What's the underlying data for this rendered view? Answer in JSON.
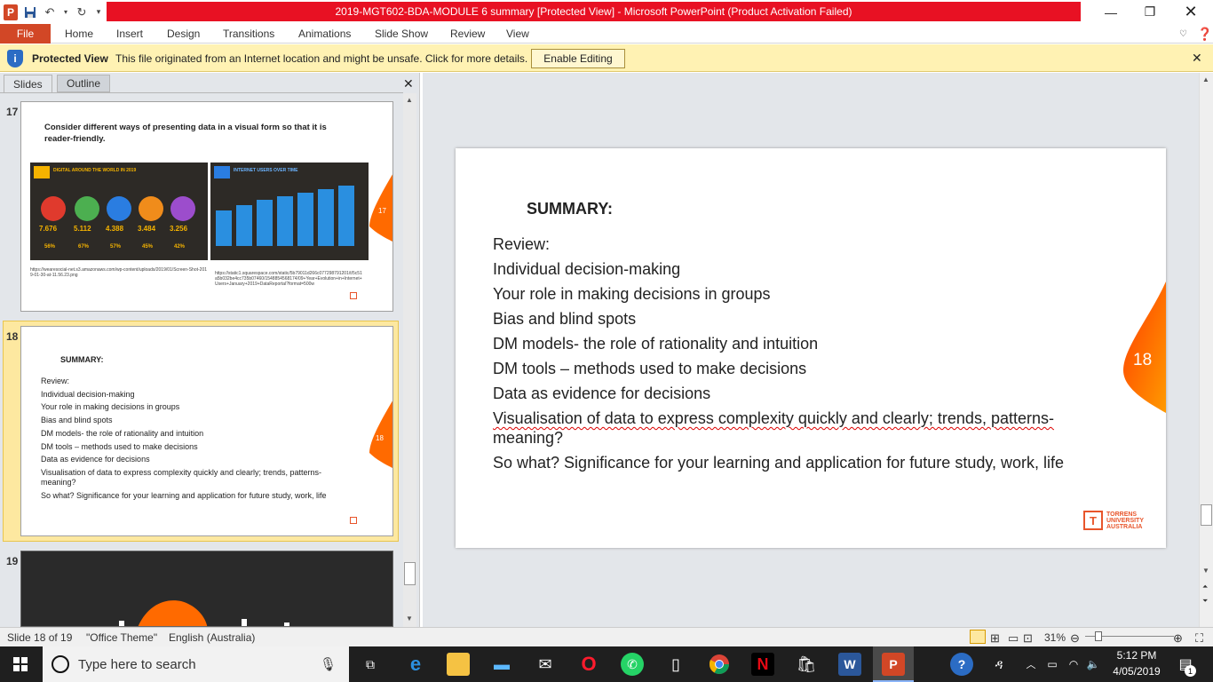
{
  "window": {
    "title": "2019-MGT602-BDA-MODULE 6 summary [Protected View]  -  Microsoft PowerPoint (Product Activation Failed)",
    "app_icon": "P"
  },
  "ribbon": {
    "file": "File",
    "tabs": [
      "Home",
      "Insert",
      "Design",
      "Transitions",
      "Animations",
      "Slide Show",
      "Review",
      "View"
    ]
  },
  "protected": {
    "title": "Protected View",
    "message": "This file originated from an Internet location and might be unsafe. Click for more details.",
    "button": "Enable Editing"
  },
  "panel": {
    "tabs": [
      "Slides",
      "Outline"
    ],
    "slide17": {
      "number": "17",
      "heading": "Consider different ways of presenting data in a visual form so that it is reader-friendly.",
      "img1_title": "DIGITAL AROUND THE WORLD IN 2019",
      "img1_stats": [
        "7.676",
        "5.112",
        "4.388",
        "3.484",
        "3.256"
      ],
      "img1_pcts": [
        "56%",
        "67%",
        "57%",
        "45%",
        "42%"
      ],
      "img2_title": "INTERNET USERS OVER TIME",
      "caption1": "https://wearesocial-net.s3.amazonaws.com/wp-content/uploads/2019/01/Screen-Shot-2019-01-30-at-11.56.23.png",
      "caption2": "https://static1.squarespace.com/static/5b79011d266c077298791201/t/5c51a5b032be4cc735b07460/1548854568174/09+Year+Evolution+in+Internet+Users+January+2019+DataReportal?format=500w",
      "page_badge": "17"
    },
    "slide18": {
      "number": "18",
      "heading": "SUMMARY:",
      "page_badge": "18"
    },
    "slide19": {
      "number": "19"
    }
  },
  "slide": {
    "heading": "SUMMARY:",
    "lines": [
      "Review:",
      "Individual decision-making",
      "Your role in making decisions in groups",
      "Bias and blind spots",
      "DM models- the role of rationality  and intuition",
      "DM tools – methods used to make decisions",
      "Data as evidence for decisions",
      "Visualisation  of data to express complexity quickly and clearly; trends, patterns-",
      "meaning?",
      "So what?  Significance for your learning and application for future study, work, life"
    ],
    "thumb_lines": [
      "Review:",
      "Individual decision-making",
      "Your role in making decisions in groups",
      "Bias and blind spots",
      "DM models- the role of rationality and intuition",
      "DM tools – methods used to make decisions",
      "Data as evidence for decisions",
      "Visualisation of data to express complexity quickly and clearly; trends, patterns-",
      "meaning?",
      "So what? Significance for your learning and application for future study, work,  life"
    ],
    "page_number": "18",
    "logo": [
      "TORRENS",
      "UNIVERSITY",
      "AUSTRALIA"
    ],
    "accent": "#ff6a00"
  },
  "status": {
    "slide": "Slide 18 of 19",
    "theme": "\"Office Theme\"",
    "language": "English (Australia)",
    "zoom": "31%"
  },
  "taskbar": {
    "search_placeholder": "Type here to search",
    "time": "5:12 PM",
    "date": "4/05/2019",
    "notification_count": "1"
  }
}
